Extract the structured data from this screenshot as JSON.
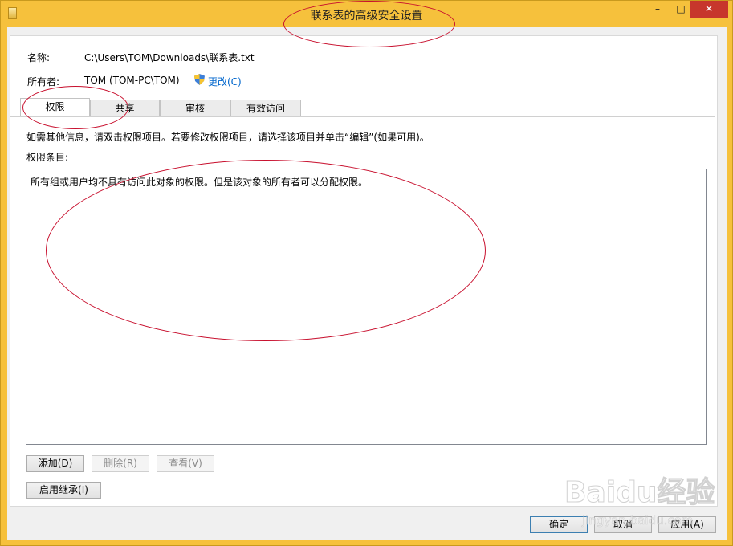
{
  "window": {
    "title": "联系表的高级安全设置"
  },
  "titlebar_buttons": {
    "minimize": "–",
    "maximize": "□",
    "close": "✕"
  },
  "info": {
    "name_label": "名称:",
    "name_value": "C:\\Users\\TOM\\Downloads\\联系表.txt",
    "owner_label": "所有者:",
    "owner_value": "TOM (TOM-PC\\TOM)",
    "change_link": "更改(C)"
  },
  "tabs": [
    {
      "label": "权限",
      "active": true
    },
    {
      "label": "共享",
      "active": false
    },
    {
      "label": "审核",
      "active": false
    },
    {
      "label": "有效访问",
      "active": false
    }
  ],
  "hint": "如需其他信息，请双击权限项目。若要修改权限项目，请选择该项目并单击“编辑”(如果可用)。",
  "list_label": "权限条目:",
  "list_message": "所有组或用户均不具有访问此对象的权限。但是该对象的所有者可以分配权限。",
  "buttons": {
    "add": "添加(D)",
    "remove": "删除(R)",
    "view": "查看(V)",
    "inherit": "启用继承(I)",
    "ok": "确定",
    "cancel": "取消",
    "apply": "应用(A)"
  },
  "watermark": {
    "text": "Baidu经验",
    "sub": "jingyan.baidu.com"
  },
  "colors": {
    "frame": "#f6c13c",
    "close": "#c7362c",
    "link": "#0066cc",
    "annotation": "#c8102e"
  }
}
